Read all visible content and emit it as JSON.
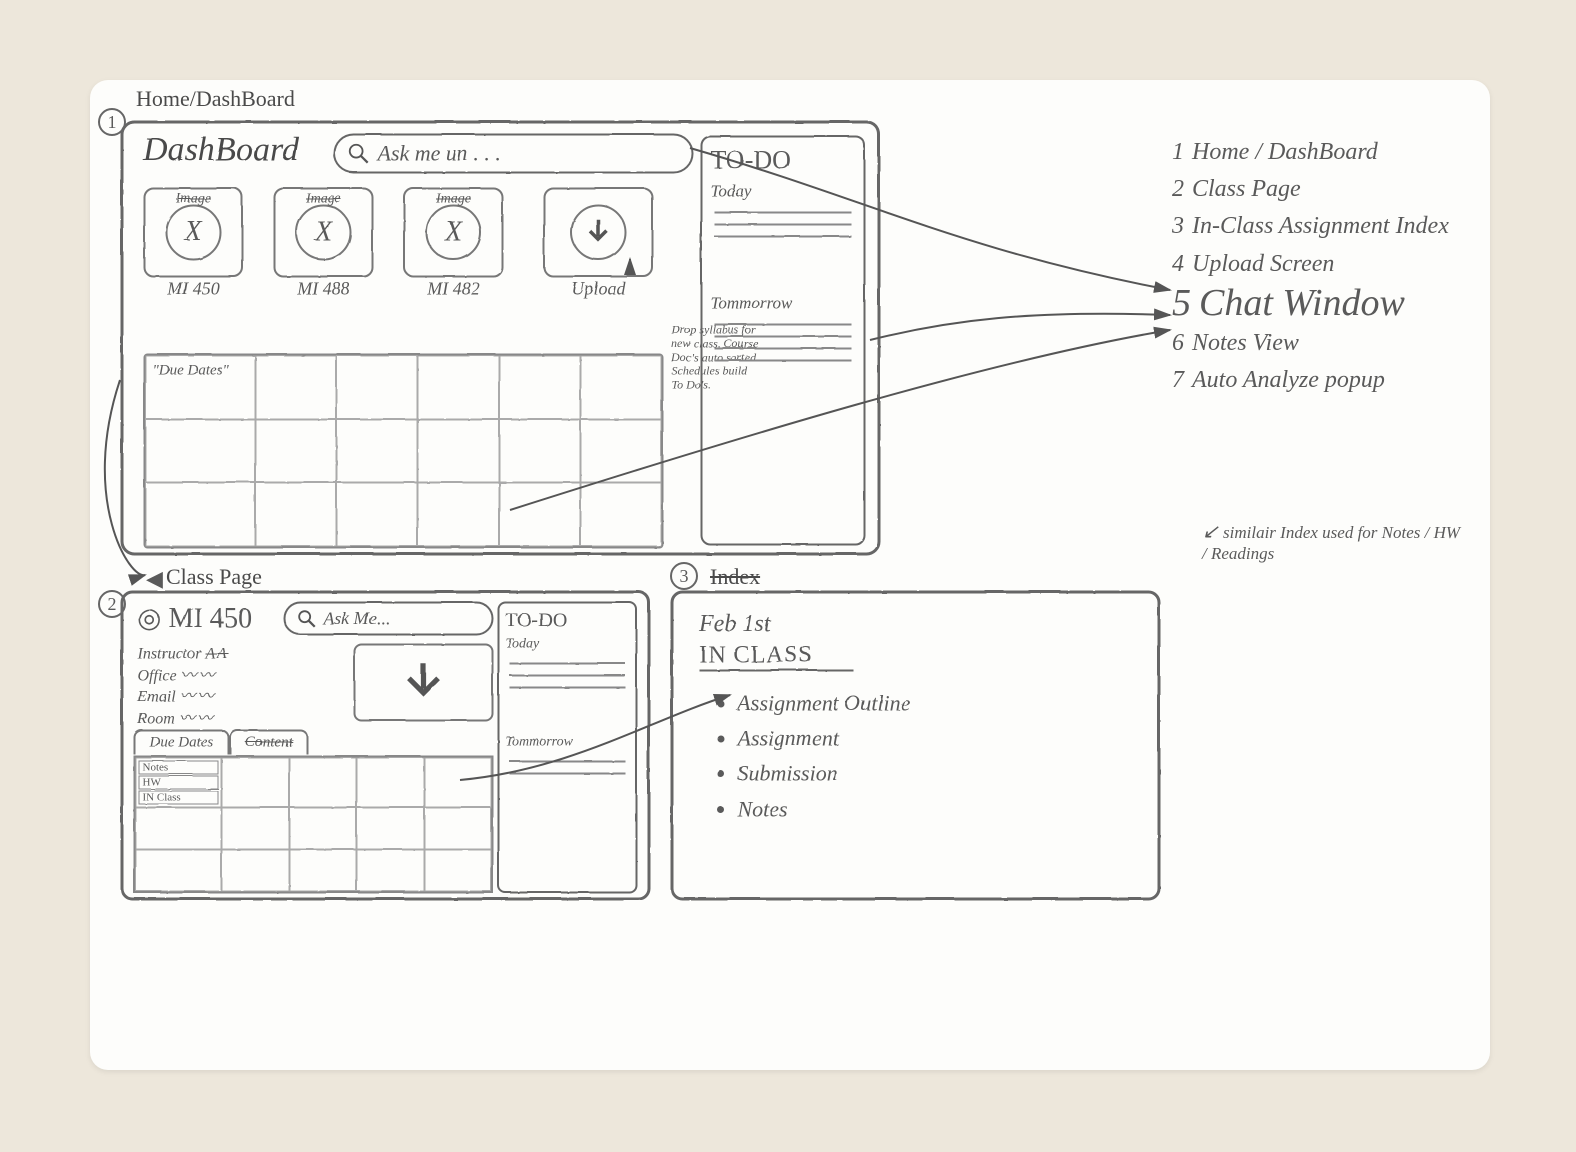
{
  "panel1": {
    "label_above": "Home/DashBoard",
    "number": "1",
    "title": "DashBoard",
    "search_placeholder": "Ask me un . . .",
    "cards": [
      {
        "img_label": "Image",
        "caption": "MI 450"
      },
      {
        "img_label": "Image",
        "caption": "MI 488"
      },
      {
        "img_label": "Image",
        "caption": "MI 482"
      }
    ],
    "upload_label": "Upload",
    "upload_note": "Drop syllabus for new class. Course Doc's auto sorted. Schedules build To Do's.",
    "calendar_cell": "\"Due Dates\"",
    "todo": {
      "heading": "TO-DO",
      "today": "Today",
      "tomorrow": "Tommorrow"
    }
  },
  "panel2": {
    "label_above": "Class Page",
    "number": "2",
    "course": "MI 450",
    "search_placeholder": "Ask Me...",
    "info": {
      "instructor": "Instructor",
      "office": "Office",
      "email": "Email",
      "room": "Room"
    },
    "tabs": {
      "due": "Due Dates",
      "content": "Content"
    },
    "stack": {
      "notes": "Notes",
      "hw": "HW",
      "inclass": "IN Class"
    },
    "todo": {
      "heading": "TO-DO",
      "today": "Today",
      "tomorrow": "Tommorrow"
    }
  },
  "panel3": {
    "label_above": "Index",
    "number": "3",
    "date": "Feb 1st",
    "heading": "IN CLASS",
    "items": [
      "Assignment Outline",
      "Assignment",
      "Submission",
      "Notes"
    ]
  },
  "legend": {
    "items": [
      "Home / DashBoard",
      "Class Page",
      "In-Class Assignment Index",
      "Upload Screen",
      "Chat Window",
      "Notes View",
      "Auto Analyze popup"
    ],
    "note": "similair Index used for Notes / HW / Readings"
  }
}
